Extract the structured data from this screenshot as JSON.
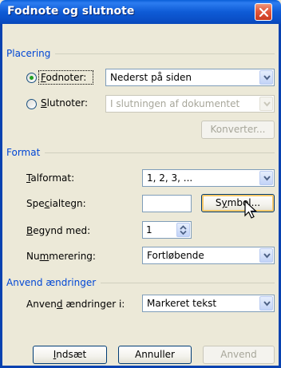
{
  "window": {
    "title": "Fodnote og slutnote"
  },
  "placering": {
    "header": "Placering",
    "fodnoter": {
      "prefix": "",
      "hotkey": "F",
      "rest": "odnoter:",
      "value": "Nederst på siden",
      "checked": true
    },
    "slutnoter": {
      "hotkey": "S",
      "rest": "lutnoter:",
      "value": "I slutningen af dokumentet",
      "checked": false
    },
    "konverter_label": "Konverter..."
  },
  "format": {
    "header": "Format",
    "talformat": {
      "hotkey": "T",
      "rest": "alformat:",
      "value": "1, 2, 3, ..."
    },
    "specialtegn": {
      "prefix": "Spe",
      "hotkey": "c",
      "rest": "ialtegn:",
      "value": ""
    },
    "symbol_label_pre": "S",
    "symbol_label_hot": "y",
    "symbol_label_post": "mbol...",
    "begynd": {
      "hotkey": "B",
      "rest": "egynd med:",
      "value": "1"
    },
    "nummerering": {
      "prefix": "Nu",
      "hotkey": "m",
      "rest": "merering:",
      "value": "Fortløbende"
    }
  },
  "anvend": {
    "header": "Anvend ændringer",
    "label_pre": "Anven",
    "label_hot": "d",
    "label_post": " ændringer i:",
    "value": "Markeret tekst"
  },
  "buttons": {
    "indsaet_hot": "I",
    "indsaet_rest": "ndsæt",
    "annuller": "Annuller",
    "anvend": "Anvend"
  },
  "colors": {
    "title_bar": "#0A5FD8",
    "group_header": "#0046D5",
    "dialog_bg": "#ECE9D8"
  }
}
